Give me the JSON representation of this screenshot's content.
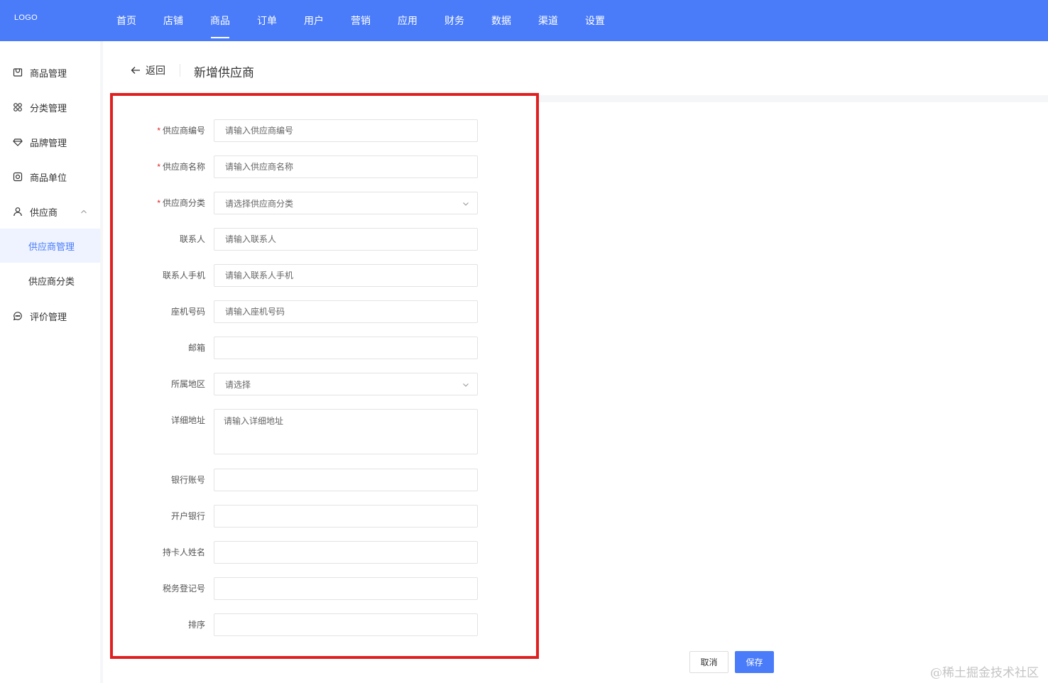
{
  "header": {
    "logo": "LOGO",
    "nav": [
      {
        "label": "首页",
        "active": false
      },
      {
        "label": "店铺",
        "active": false
      },
      {
        "label": "商品",
        "active": true
      },
      {
        "label": "订单",
        "active": false
      },
      {
        "label": "用户",
        "active": false
      },
      {
        "label": "营销",
        "active": false
      },
      {
        "label": "应用",
        "active": false
      },
      {
        "label": "财务",
        "active": false
      },
      {
        "label": "数据",
        "active": false
      },
      {
        "label": "渠道",
        "active": false
      },
      {
        "label": "设置",
        "active": false
      }
    ]
  },
  "sidebar": {
    "items": [
      {
        "label": "商品管理",
        "icon": "product-icon"
      },
      {
        "label": "分类管理",
        "icon": "category-icon"
      },
      {
        "label": "品牌管理",
        "icon": "brand-icon"
      },
      {
        "label": "商品单位",
        "icon": "unit-icon"
      },
      {
        "label": "供应商",
        "icon": "supplier-icon",
        "expanded": true
      },
      {
        "label": "评价管理",
        "icon": "comment-icon"
      }
    ],
    "sub_items": [
      {
        "label": "供应商管理",
        "active": true
      },
      {
        "label": "供应商分类",
        "active": false
      }
    ]
  },
  "page": {
    "back_label": "返回",
    "title": "新增供应商"
  },
  "form": {
    "supplier_code": {
      "label": "供应商编号",
      "placeholder": "请输入供应商编号",
      "required": true
    },
    "supplier_name": {
      "label": "供应商名称",
      "placeholder": "请输入供应商名称",
      "required": true
    },
    "supplier_category": {
      "label": "供应商分类",
      "placeholder": "请选择供应商分类",
      "required": true
    },
    "contact": {
      "label": "联系人",
      "placeholder": "请输入联系人"
    },
    "contact_phone": {
      "label": "联系人手机",
      "placeholder": "请输入联系人手机"
    },
    "landline": {
      "label": "座机号码",
      "placeholder": "请输入座机号码"
    },
    "email": {
      "label": "邮箱",
      "placeholder": ""
    },
    "region": {
      "label": "所属地区",
      "placeholder": "请选择"
    },
    "address": {
      "label": "详细地址",
      "placeholder": "请输入详细地址"
    },
    "bank_account": {
      "label": "银行账号",
      "placeholder": ""
    },
    "bank_name": {
      "label": "开户银行",
      "placeholder": ""
    },
    "cardholder": {
      "label": "持卡人姓名",
      "placeholder": ""
    },
    "tax_number": {
      "label": "税务登记号",
      "placeholder": ""
    },
    "sort": {
      "label": "排序",
      "placeholder": ""
    }
  },
  "actions": {
    "cancel": "取消",
    "save": "保存"
  },
  "watermark": "@稀土掘金技术社区",
  "colors": {
    "primary": "#4a7cf9",
    "highlight_border": "#e02020",
    "required": "#e02020"
  }
}
